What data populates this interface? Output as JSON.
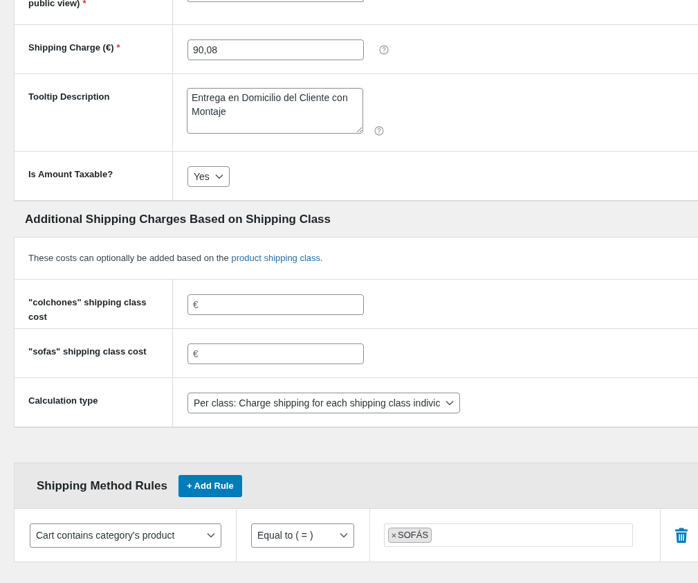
{
  "fields": [
    {
      "kind": "cut",
      "label": "public view)",
      "required_mark": "*"
    },
    {
      "kind": "text",
      "label": "Shipping Charge (€)",
      "required_mark": "*",
      "value": "90,08",
      "help": true
    },
    {
      "kind": "textarea",
      "label": "Tooltip Description",
      "value": "Entrega en Domicilio del Cliente con Montaje",
      "help": true
    },
    {
      "kind": "select",
      "label": "Is Amount Taxable?",
      "value": "Yes"
    }
  ],
  "class_section": {
    "heading": "Additional Shipping Charges Based on Shipping Class",
    "intro": {
      "text": "These costs can optionally be added based on the ",
      "link": "product shipping class",
      "end": "."
    },
    "fields": [
      {
        "kind": "text",
        "label": "\"colchones\" shipping class cost",
        "placeholder": "€"
      },
      {
        "kind": "text",
        "label": "\"sofas\" shipping class cost",
        "placeholder": "€"
      },
      {
        "kind": "select",
        "label": "Calculation type",
        "value": "Per class: Charge shipping for each shipping class indivic"
      }
    ]
  },
  "rules": {
    "title": "Shipping Method Rules",
    "add_button": "+ Add Rule",
    "rows": [
      {
        "condition": "Cart contains category's product",
        "operator": "Equal to ( = )",
        "tags": [
          "SOFÁS"
        ]
      }
    ]
  }
}
